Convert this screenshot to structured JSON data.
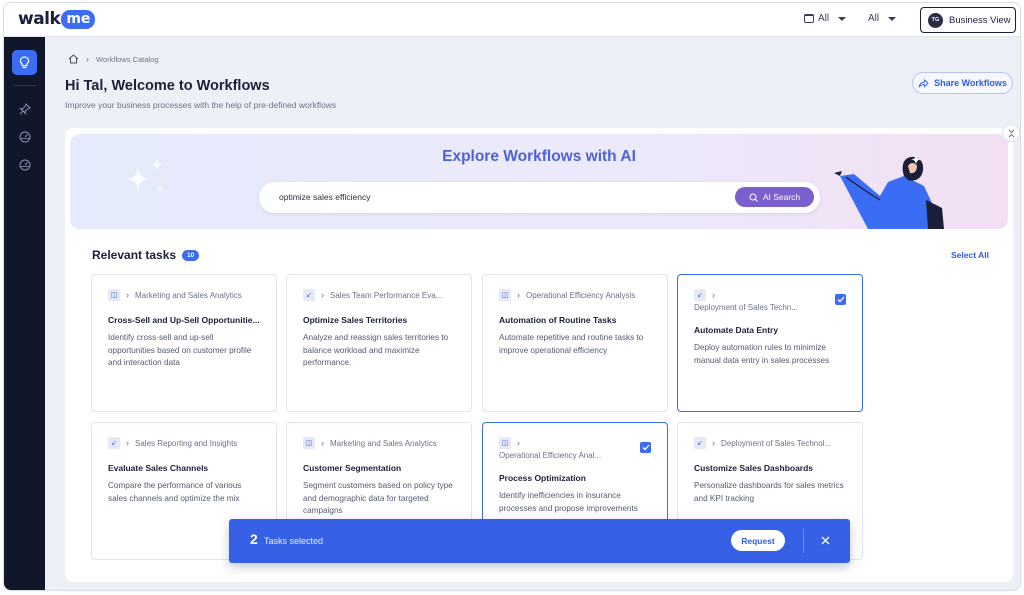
{
  "topbar": {
    "logo_part1": "walk",
    "logo_part2": "me",
    "filter1_label": "All",
    "filter2_label": "All",
    "view_button": "Business View",
    "avatar_initials": "TG"
  },
  "breadcrumb": {
    "item": "Workflows Catalog"
  },
  "header": {
    "title": "Hi Tal, Welcome to Workflows",
    "subtitle": "Improve your business processes with the help of pre-defined workflows",
    "share_button": "Share Workflows"
  },
  "banner": {
    "title": "Explore Workflows with AI",
    "search_value": "optimize sales efficiency",
    "ai_button": "AI Search"
  },
  "tasks": {
    "heading": "Relevant tasks",
    "count": "10",
    "select_all": "Select All",
    "cards": [
      {
        "category": "Marketing and Sales Analytics",
        "title": "Cross-Sell and Up-Sell Opportunitie...",
        "description": "Identify cross-sell and up-sell opportunities based on customer profile and interaction data",
        "selected": false
      },
      {
        "category": "Sales Team Performance Eva...",
        "title": "Optimize Sales Territories",
        "description": "Analyze and reassign sales territories to balance workload and maximize performance.",
        "selected": false
      },
      {
        "category": "Operational Efficiency Analysis",
        "title": "Automation of Routine Tasks",
        "description": "Automate repetitive and routine tasks to improve operational efficiency",
        "selected": false
      },
      {
        "category": "Deployment of Sales Techn...",
        "title": "Automate Data Entry",
        "description": "Deploy automation rules to minimize manual data entry in sales processes",
        "selected": true
      },
      {
        "category": "Sales Reporting and Insights",
        "title": "Evaluate Sales Channels",
        "description": "Compare the performance of various sales channels and optimize the mix",
        "selected": false
      },
      {
        "category": "Marketing and Sales Analytics",
        "title": "Customer Segmentation",
        "description": "Segment customers based on policy type and demographic data for targeted campaigns",
        "selected": false
      },
      {
        "category": "Operational Efficiency Anal...",
        "title": "Process Optimization",
        "description": "Identify inefficiencies in insurance processes and propose improvements",
        "selected": true
      },
      {
        "category": "Deployment of Sales Technol...",
        "title": "Customize Sales Dashboards",
        "description": "Personalize dashboards for sales metrics and KPI tracking",
        "selected": false
      }
    ]
  },
  "selection_bar": {
    "count": "2",
    "label": "Tasks selected",
    "request_button": "Request"
  },
  "colors": {
    "accent": "#3a6cf4",
    "sidebar": "#10172b",
    "ai_button": "#7c5fcf",
    "selection_bar": "#3660e6"
  }
}
